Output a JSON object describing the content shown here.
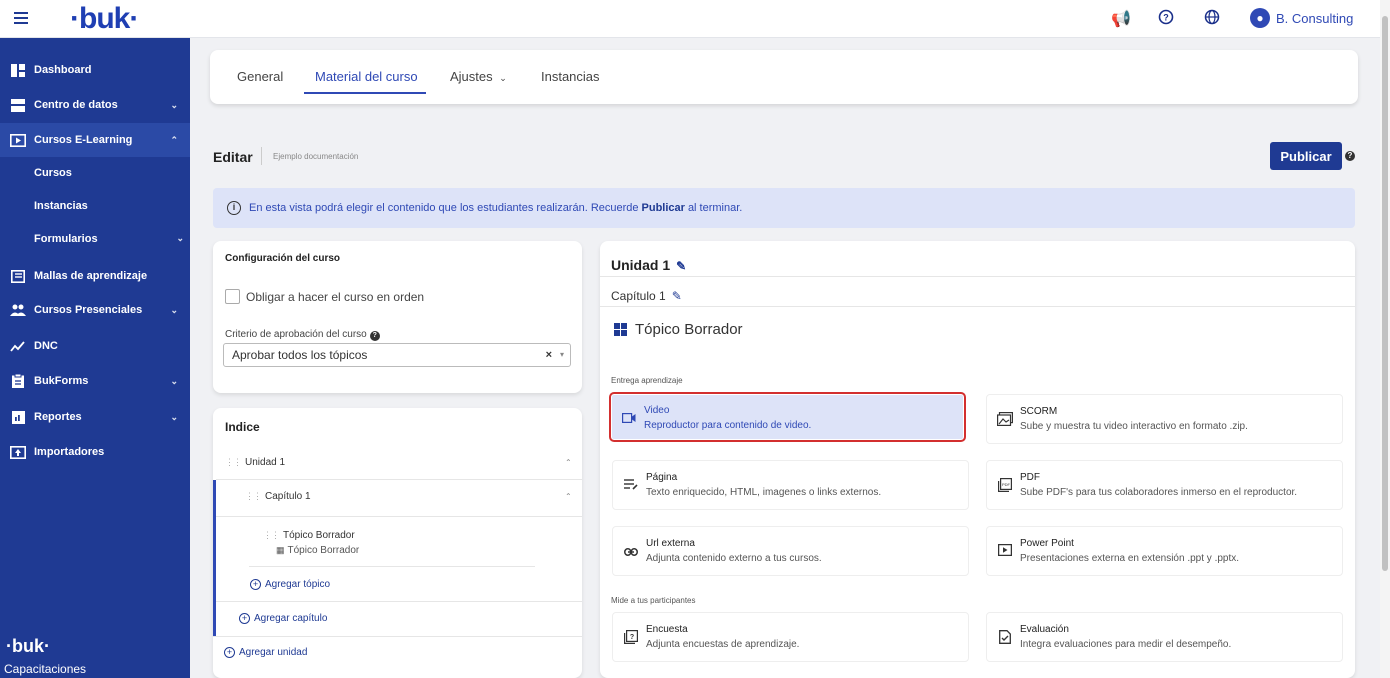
{
  "topbar": {
    "logo": "·buk·",
    "user_name": "B. Consulting",
    "icons": [
      "megaphone-icon",
      "help-icon",
      "globe-icon",
      "user-icon"
    ]
  },
  "sidebar": {
    "items": [
      {
        "label": "Dashboard",
        "icon": "dashboard-icon"
      },
      {
        "label": "Centro de datos",
        "icon": "database-icon"
      },
      {
        "label": "Cursos E-Learning",
        "icon": "play-icon"
      },
      {
        "label": "Cursos"
      },
      {
        "label": "Instancias"
      },
      {
        "label": "Formularios"
      },
      {
        "label": "Mallas de aprendizaje",
        "icon": "book-icon"
      },
      {
        "label": "Cursos Presenciales",
        "icon": "people-icon"
      },
      {
        "label": "DNC",
        "icon": "chart-hand-icon"
      },
      {
        "label": "BukForms",
        "icon": "clipboard-icon"
      },
      {
        "label": "Reportes",
        "icon": "report-icon"
      },
      {
        "label": "Importadores",
        "icon": "import-icon"
      }
    ],
    "footer_logo": "·buk·",
    "footer_app": "Capacitaciones"
  },
  "tabs": [
    {
      "label": "General"
    },
    {
      "label": "Material del curso"
    },
    {
      "label": "Ajustes"
    },
    {
      "label": "Instancias"
    }
  ],
  "edit": {
    "title": "Editar",
    "subtitle": "Ejemplo documentación",
    "publish_label": "Publicar"
  },
  "info": {
    "text_before": "En esta vista podrá elegir el contenido que los estudiantes realizarán. Recuerde",
    "bold": "Publicar",
    "text_after": "al terminar."
  },
  "config": {
    "title": "Configuración del curso",
    "checkbox_label": "Obligar a hacer el curso en orden",
    "criteria_label": "Criterio de aprobación del curso",
    "criteria_value": "Aprobar todos los tópicos"
  },
  "index": {
    "title": "Indice",
    "unit": "Unidad 1",
    "chapter": "Capítulo 1",
    "topic": "Tópico Borrador",
    "topic_sub": "Tópico Borrador",
    "add_topic": "Agregar tópico",
    "add_chapter": "Agregar capítulo",
    "add_unit": "Agregar unidad"
  },
  "editor": {
    "unit": "Unidad 1",
    "chapter": "Capítulo 1",
    "topic_title": "Tópico Borrador",
    "section1": "Entrega aprendizaje",
    "section2": "Mide a tus participantes",
    "options": [
      {
        "title": "Video",
        "desc": "Reproductor para contenido de video.",
        "icon": "video-icon"
      },
      {
        "title": "SCORM",
        "desc": "Sube y muestra tu video interactivo en formato .zip.",
        "icon": "scorm-icon"
      },
      {
        "title": "Página",
        "desc": "Texto enriquecido, HTML, imagenes o links externos.",
        "icon": "page-icon"
      },
      {
        "title": "PDF",
        "desc": "Sube PDF's para tus colaboradores inmerso en el reproductor.",
        "icon": "pdf-icon"
      },
      {
        "title": "Url externa",
        "desc": "Adjunta contenido externo a tus cursos.",
        "icon": "link-icon"
      },
      {
        "title": "Power Point",
        "desc": "Presentaciones externa en extensión .ppt y .pptx.",
        "icon": "slides-icon"
      },
      {
        "title": "Encuesta",
        "desc": "Adjunta encuestas de aprendizaje.",
        "icon": "survey-icon"
      },
      {
        "title": "Evaluación",
        "desc": "Integra evaluaciones para medir el desempeño.",
        "icon": "evaluation-icon"
      }
    ],
    "selected": "Video"
  }
}
